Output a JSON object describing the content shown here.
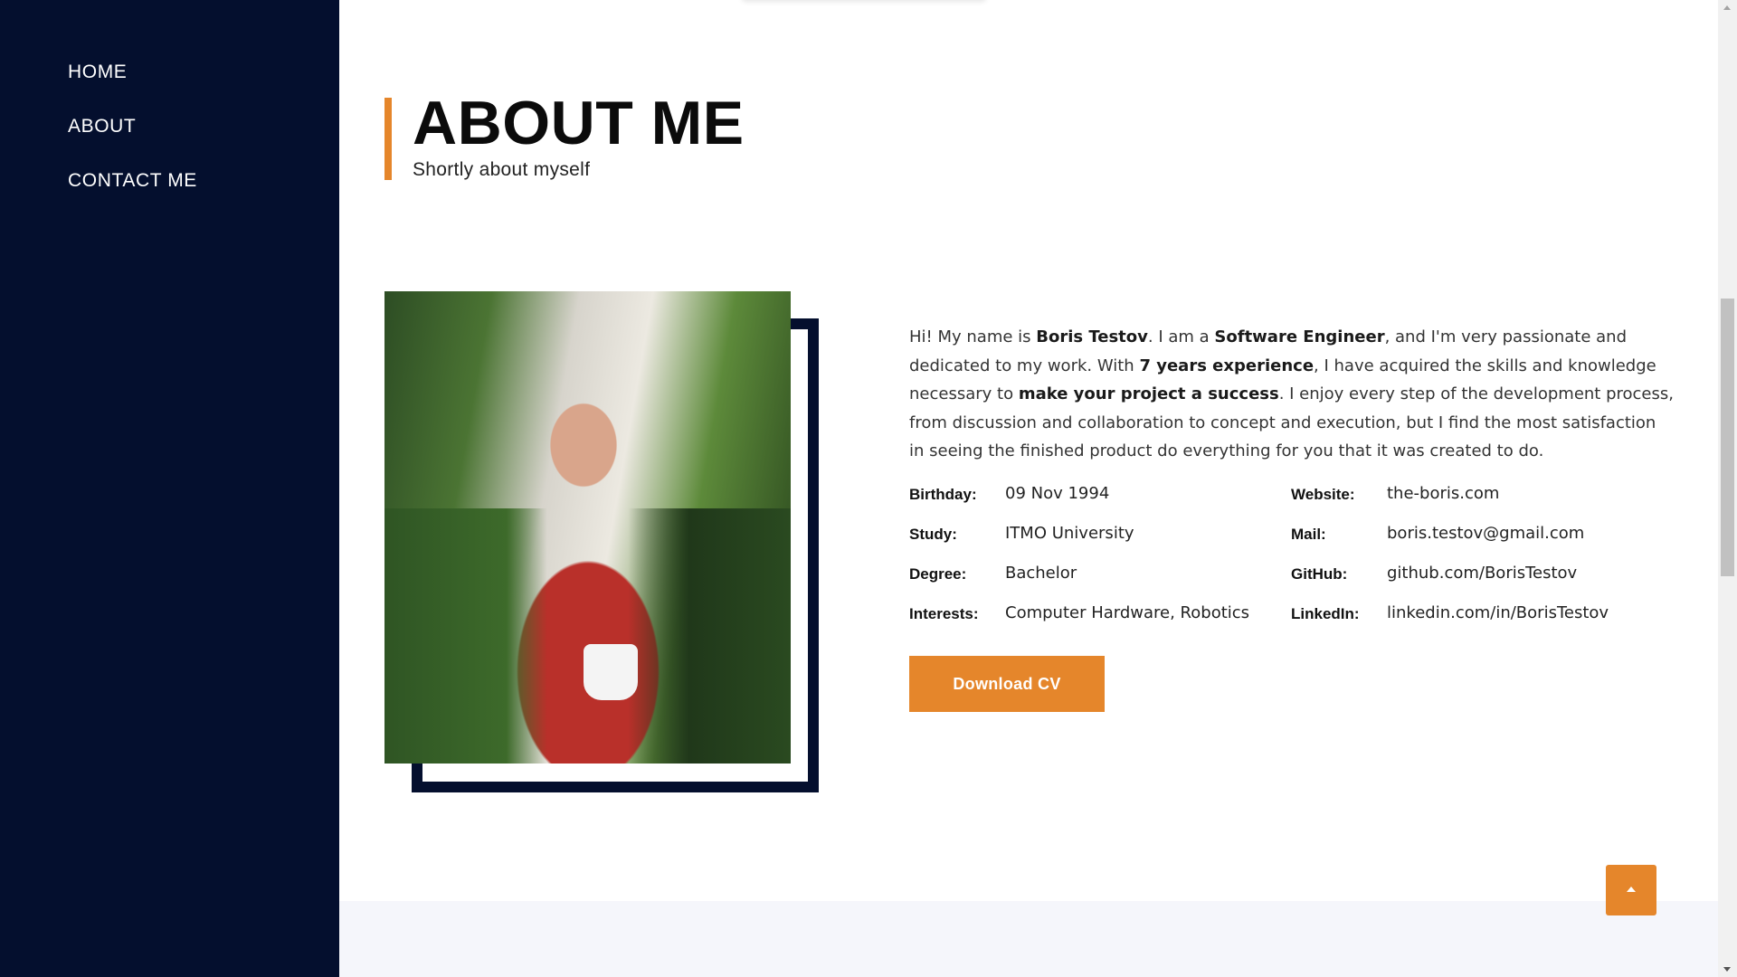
{
  "sidebar": {
    "items": [
      {
        "label": "HOME"
      },
      {
        "label": "ABOUT"
      },
      {
        "label": "CONTACT ME"
      }
    ]
  },
  "about": {
    "title": "ABOUT ME",
    "subtitle": "Shortly about myself",
    "bio": {
      "p1": "Hi! My name is ",
      "name": "Boris Testov",
      "p2": ". I am a ",
      "role": "Software Engineer",
      "p3": ", and I'm very passionate and dedicated to my work. With ",
      "experience": "7 years experience",
      "p4": ", I have acquired the skills and knowledge necessary to ",
      "promise": "make your project a success",
      "p5": ". I enjoy every step of the development process, from discussion and collaboration to concept and execution, but I find the most satisfaction in seeing the finished product do everything for you that it was created to do."
    },
    "info_left": [
      {
        "key": "Birthday:",
        "value": "09 Nov 1994"
      },
      {
        "key": "Study:",
        "value": "ITMO University"
      },
      {
        "key": "Degree:",
        "value": "Bachelor"
      },
      {
        "key": "Interests:",
        "value": "Computer Hardware, Robotics"
      }
    ],
    "info_right": [
      {
        "key": "Website:",
        "value": "the-boris.com"
      },
      {
        "key": "Mail:",
        "value": "boris.testov@gmail.com"
      },
      {
        "key": "GitHub:",
        "value": "github.com/BorisTestov"
      },
      {
        "key": "LinkedIn:",
        "value": "linkedin.com/in/BorisTestov"
      }
    ],
    "download_label": "Download CV"
  },
  "colors": {
    "sidebar_bg": "#040f2e",
    "accent": "#e5862b",
    "section_alt_bg": "#f5f6fb"
  },
  "icons": {
    "back_to_top": "caret-up-icon"
  }
}
